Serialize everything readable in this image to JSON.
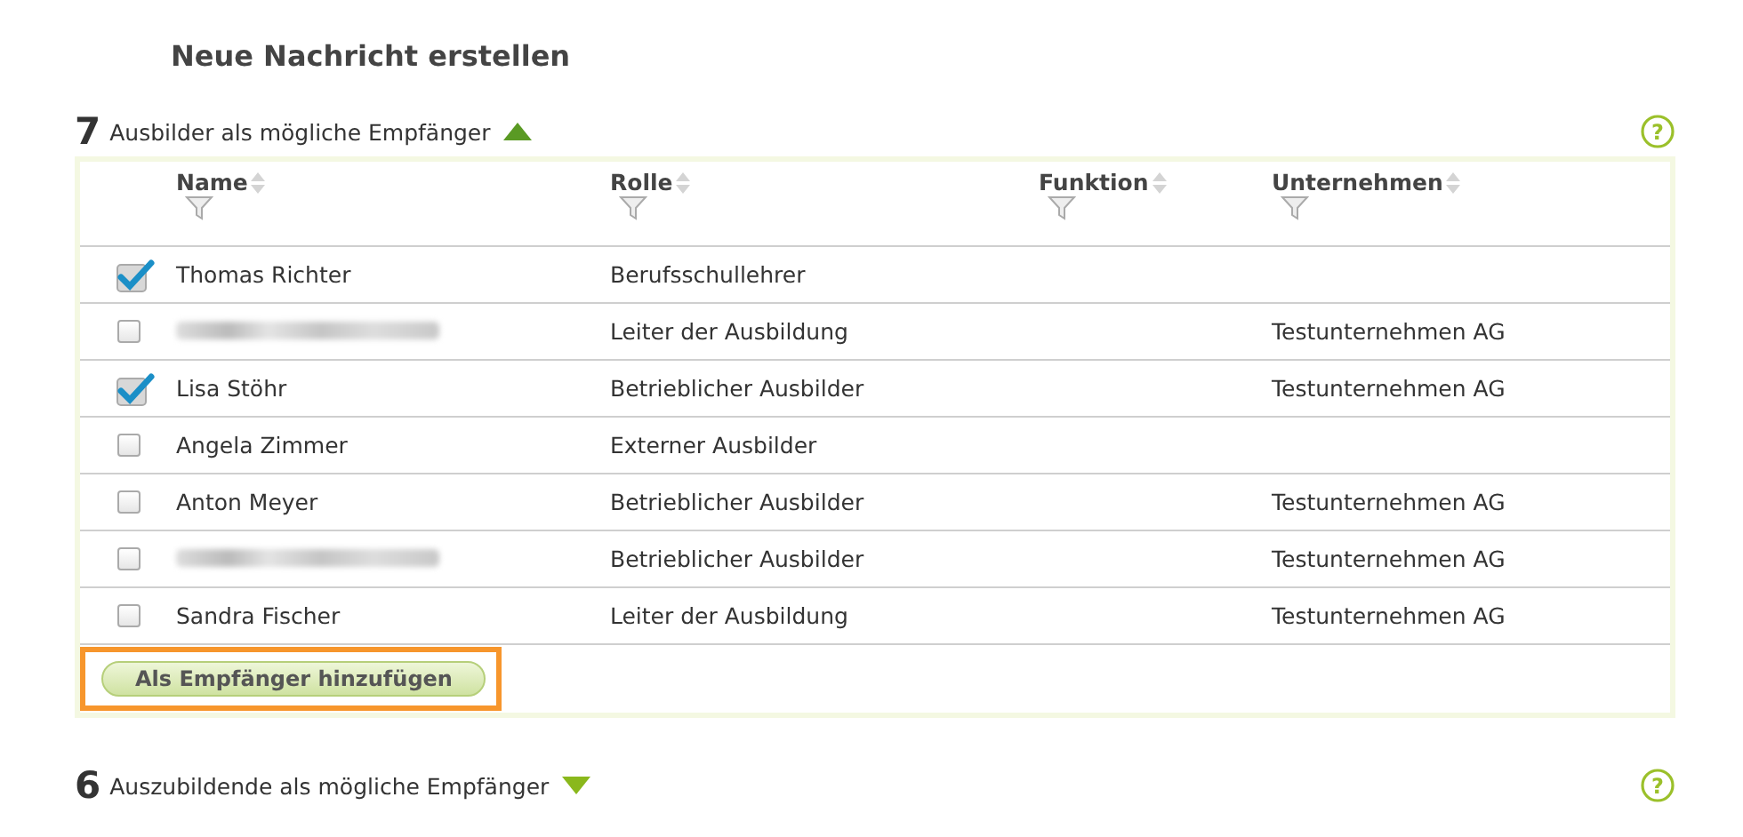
{
  "page_title": "Neue Nachricht erstellen",
  "sections": [
    {
      "count": "7",
      "label": "Ausbilder als mögliche Empfänger",
      "expanded": true,
      "help": "?",
      "table": {
        "columns": [
          "Name",
          "Rolle",
          "Funktion",
          "Unternehmen"
        ],
        "rows": [
          {
            "checked": true,
            "blurred": false,
            "name": "Thomas Richter",
            "role": "Berufsschullehrer",
            "company": ""
          },
          {
            "checked": false,
            "blurred": true,
            "name": "",
            "role": "Leiter der Ausbildung",
            "company": "Testunternehmen AG"
          },
          {
            "checked": true,
            "blurred": false,
            "name": "Lisa Stöhr",
            "role": "Betrieblicher Ausbilder",
            "company": "Testunternehmen AG"
          },
          {
            "checked": false,
            "blurred": false,
            "name": "Angela Zimmer",
            "role": "Externer Ausbilder",
            "company": ""
          },
          {
            "checked": false,
            "blurred": false,
            "name": "Anton Meyer",
            "role": "Betrieblicher Ausbilder",
            "company": "Testunternehmen AG"
          },
          {
            "checked": false,
            "blurred": true,
            "name": "",
            "role": "Betrieblicher Ausbilder",
            "company": "Testunternehmen AG"
          },
          {
            "checked": false,
            "blurred": false,
            "name": "Sandra Fischer",
            "role": "Leiter der Ausbildung",
            "company": "Testunternehmen AG"
          }
        ],
        "button": {
          "label": "Als Empfänger hinzufügen",
          "highlighted": true
        }
      }
    },
    {
      "count": "6",
      "label": "Auszubildende als mögliche Empfänger",
      "expanded": false,
      "help": "?"
    }
  ]
}
